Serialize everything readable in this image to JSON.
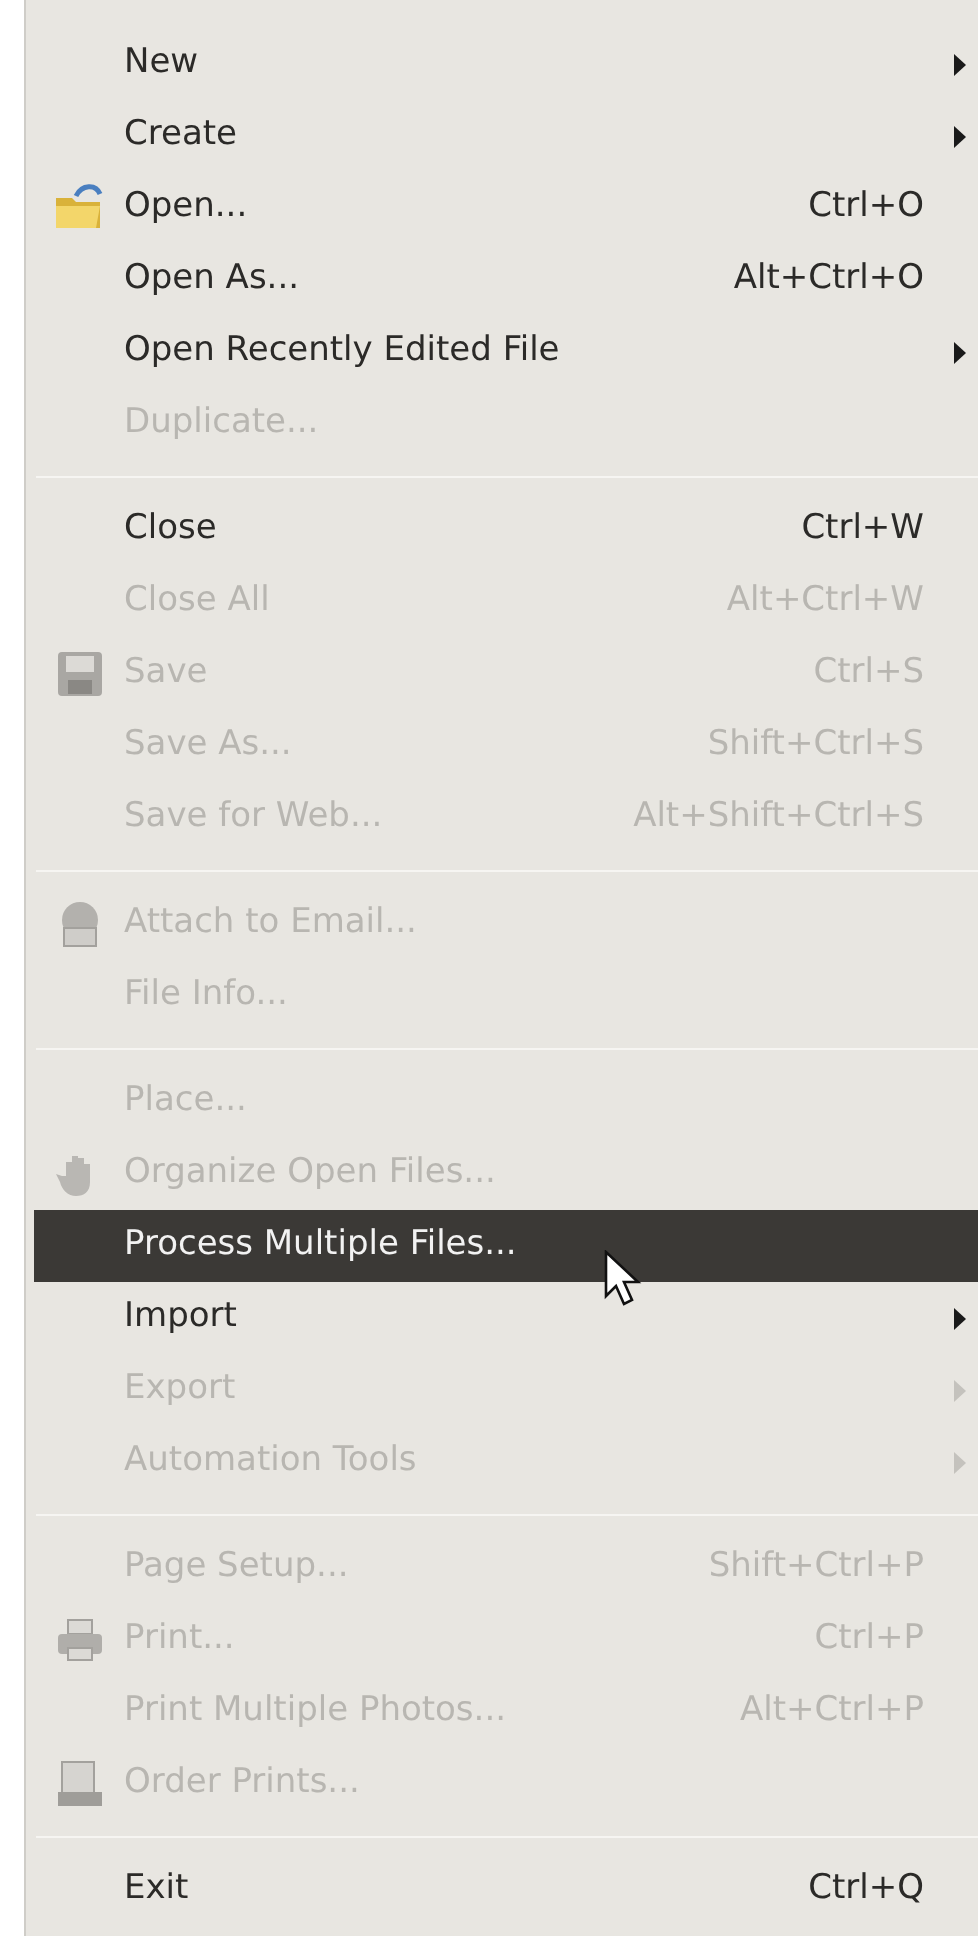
{
  "menu": {
    "sections": [
      {
        "items": [
          {
            "label": "New",
            "submenu": true,
            "disabled": false,
            "selected": false
          },
          {
            "label": "Create",
            "submenu": true,
            "disabled": false,
            "selected": false
          },
          {
            "label": "Open...",
            "shortcut": "Ctrl+O",
            "submenu": false,
            "disabled": false,
            "selected": false
          },
          {
            "label": "Open As...",
            "shortcut": "Alt+Ctrl+O",
            "submenu": false,
            "disabled": false,
            "selected": false
          },
          {
            "label": "Open Recently Edited File",
            "submenu": true,
            "disabled": false,
            "selected": false
          },
          {
            "label": "Duplicate...",
            "submenu": false,
            "disabled": true,
            "selected": false
          }
        ]
      },
      {
        "items": [
          {
            "label": "Close",
            "shortcut": "Ctrl+W",
            "submenu": false,
            "disabled": false,
            "selected": false
          },
          {
            "label": "Close All",
            "shortcut": "Alt+Ctrl+W",
            "submenu": false,
            "disabled": true,
            "selected": false
          },
          {
            "label": "Save",
            "shortcut": "Ctrl+S",
            "submenu": false,
            "disabled": true,
            "selected": false
          },
          {
            "label": "Save As...",
            "shortcut": "Shift+Ctrl+S",
            "submenu": false,
            "disabled": true,
            "selected": false
          },
          {
            "label": "Save for Web...",
            "shortcut": "Alt+Shift+Ctrl+S",
            "submenu": false,
            "disabled": true,
            "selected": false
          }
        ]
      },
      {
        "items": [
          {
            "label": "Attach to Email...",
            "submenu": false,
            "disabled": true,
            "selected": false
          },
          {
            "label": "File Info...",
            "submenu": false,
            "disabled": true,
            "selected": false
          }
        ]
      },
      {
        "items": [
          {
            "label": "Place...",
            "submenu": false,
            "disabled": true,
            "selected": false
          },
          {
            "label": "Organize Open Files...",
            "submenu": false,
            "disabled": true,
            "selected": false
          },
          {
            "label": "Process Multiple Files...",
            "submenu": false,
            "disabled": false,
            "selected": true
          },
          {
            "label": "Import",
            "submenu": true,
            "disabled": false,
            "selected": false
          },
          {
            "label": "Export",
            "submenu": true,
            "disabled": true,
            "selected": false
          },
          {
            "label": "Automation Tools",
            "submenu": true,
            "disabled": true,
            "selected": false
          }
        ]
      },
      {
        "items": [
          {
            "label": "Page Setup...",
            "shortcut": "Shift+Ctrl+P",
            "submenu": false,
            "disabled": true,
            "selected": false
          },
          {
            "label": "Print...",
            "shortcut": "Ctrl+P",
            "submenu": false,
            "disabled": true,
            "selected": false
          },
          {
            "label": "Print Multiple Photos...",
            "shortcut": "Alt+Ctrl+P",
            "submenu": false,
            "disabled": true,
            "selected": false
          },
          {
            "label": "Order Prints...",
            "submenu": false,
            "disabled": true,
            "selected": false
          }
        ]
      },
      {
        "items": [
          {
            "label": "Exit",
            "shortcut": "Ctrl+Q",
            "submenu": false,
            "disabled": false,
            "selected": false
          }
        ]
      }
    ]
  }
}
